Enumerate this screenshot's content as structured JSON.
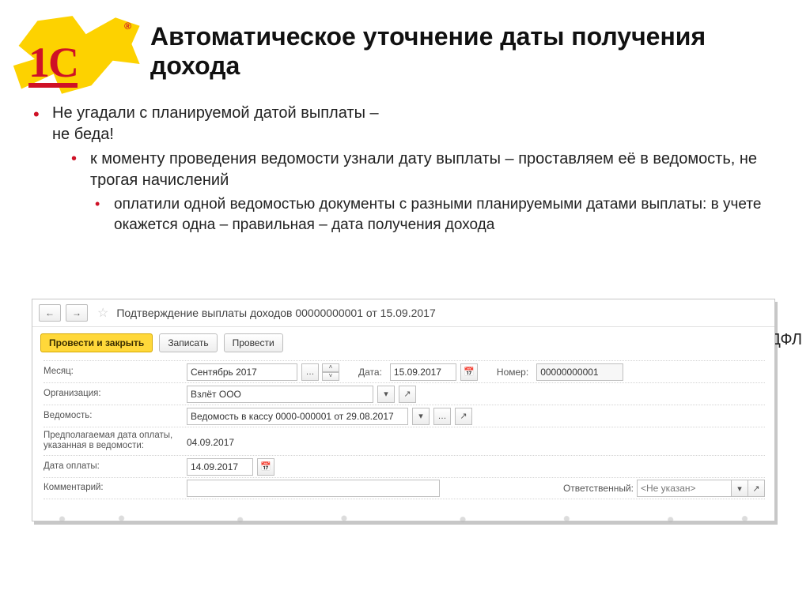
{
  "logo": {
    "mark": "1С",
    "reg": "®"
  },
  "slide": {
    "title": "Автоматическое уточнение даты получения дохода",
    "b1_line1": "Не угадали с планируемой датой выплаты –",
    "b1_line2": "не беда!",
    "b2": "к моменту проведения ведомости узнали дату выплаты – проставляем её в ведомость, не трогая начислений",
    "b3": "оплатили одной ведомостью документы с разными планируемыми датами выплаты: в учете окажется одна – правильная – дата получения дохода",
    "side_fragment": "ДФЛ"
  },
  "window": {
    "title": "Подтверждение выплаты доходов 00000000001 от 15.09.2017",
    "nav_back": "←",
    "nav_fwd": "→",
    "star": "☆"
  },
  "toolbar": {
    "primary": "Провести и закрыть",
    "save": "Записать",
    "post": "Провести"
  },
  "form": {
    "month_lbl": "Месяц:",
    "month_val": "Сентябрь 2017",
    "date_lbl": "Дата:",
    "date_val": "15.09.2017",
    "number_lbl": "Номер:",
    "number_val": "00000000001",
    "org_lbl": "Организация:",
    "org_val": "Взлёт ООО",
    "vedomost_lbl": "Ведомость:",
    "vedomost_val": "Ведомость в кассу 0000-000001 от 29.08.2017",
    "expected_lbl": "Предполагаемая дата оплаты, указанная в ведомости:",
    "expected_val": "04.09.2017",
    "paydate_lbl": "Дата оплаты:",
    "paydate_val": "14.09.2017",
    "comment_lbl": "Комментарий:",
    "responsible_lbl": "Ответственный:",
    "responsible_val": "<Не указан>"
  },
  "icons": {
    "ellipsis": "…",
    "spin_up": "˄",
    "spin_down": "˅",
    "calendar": "📅",
    "dropdown": "▾",
    "open": "↗"
  }
}
